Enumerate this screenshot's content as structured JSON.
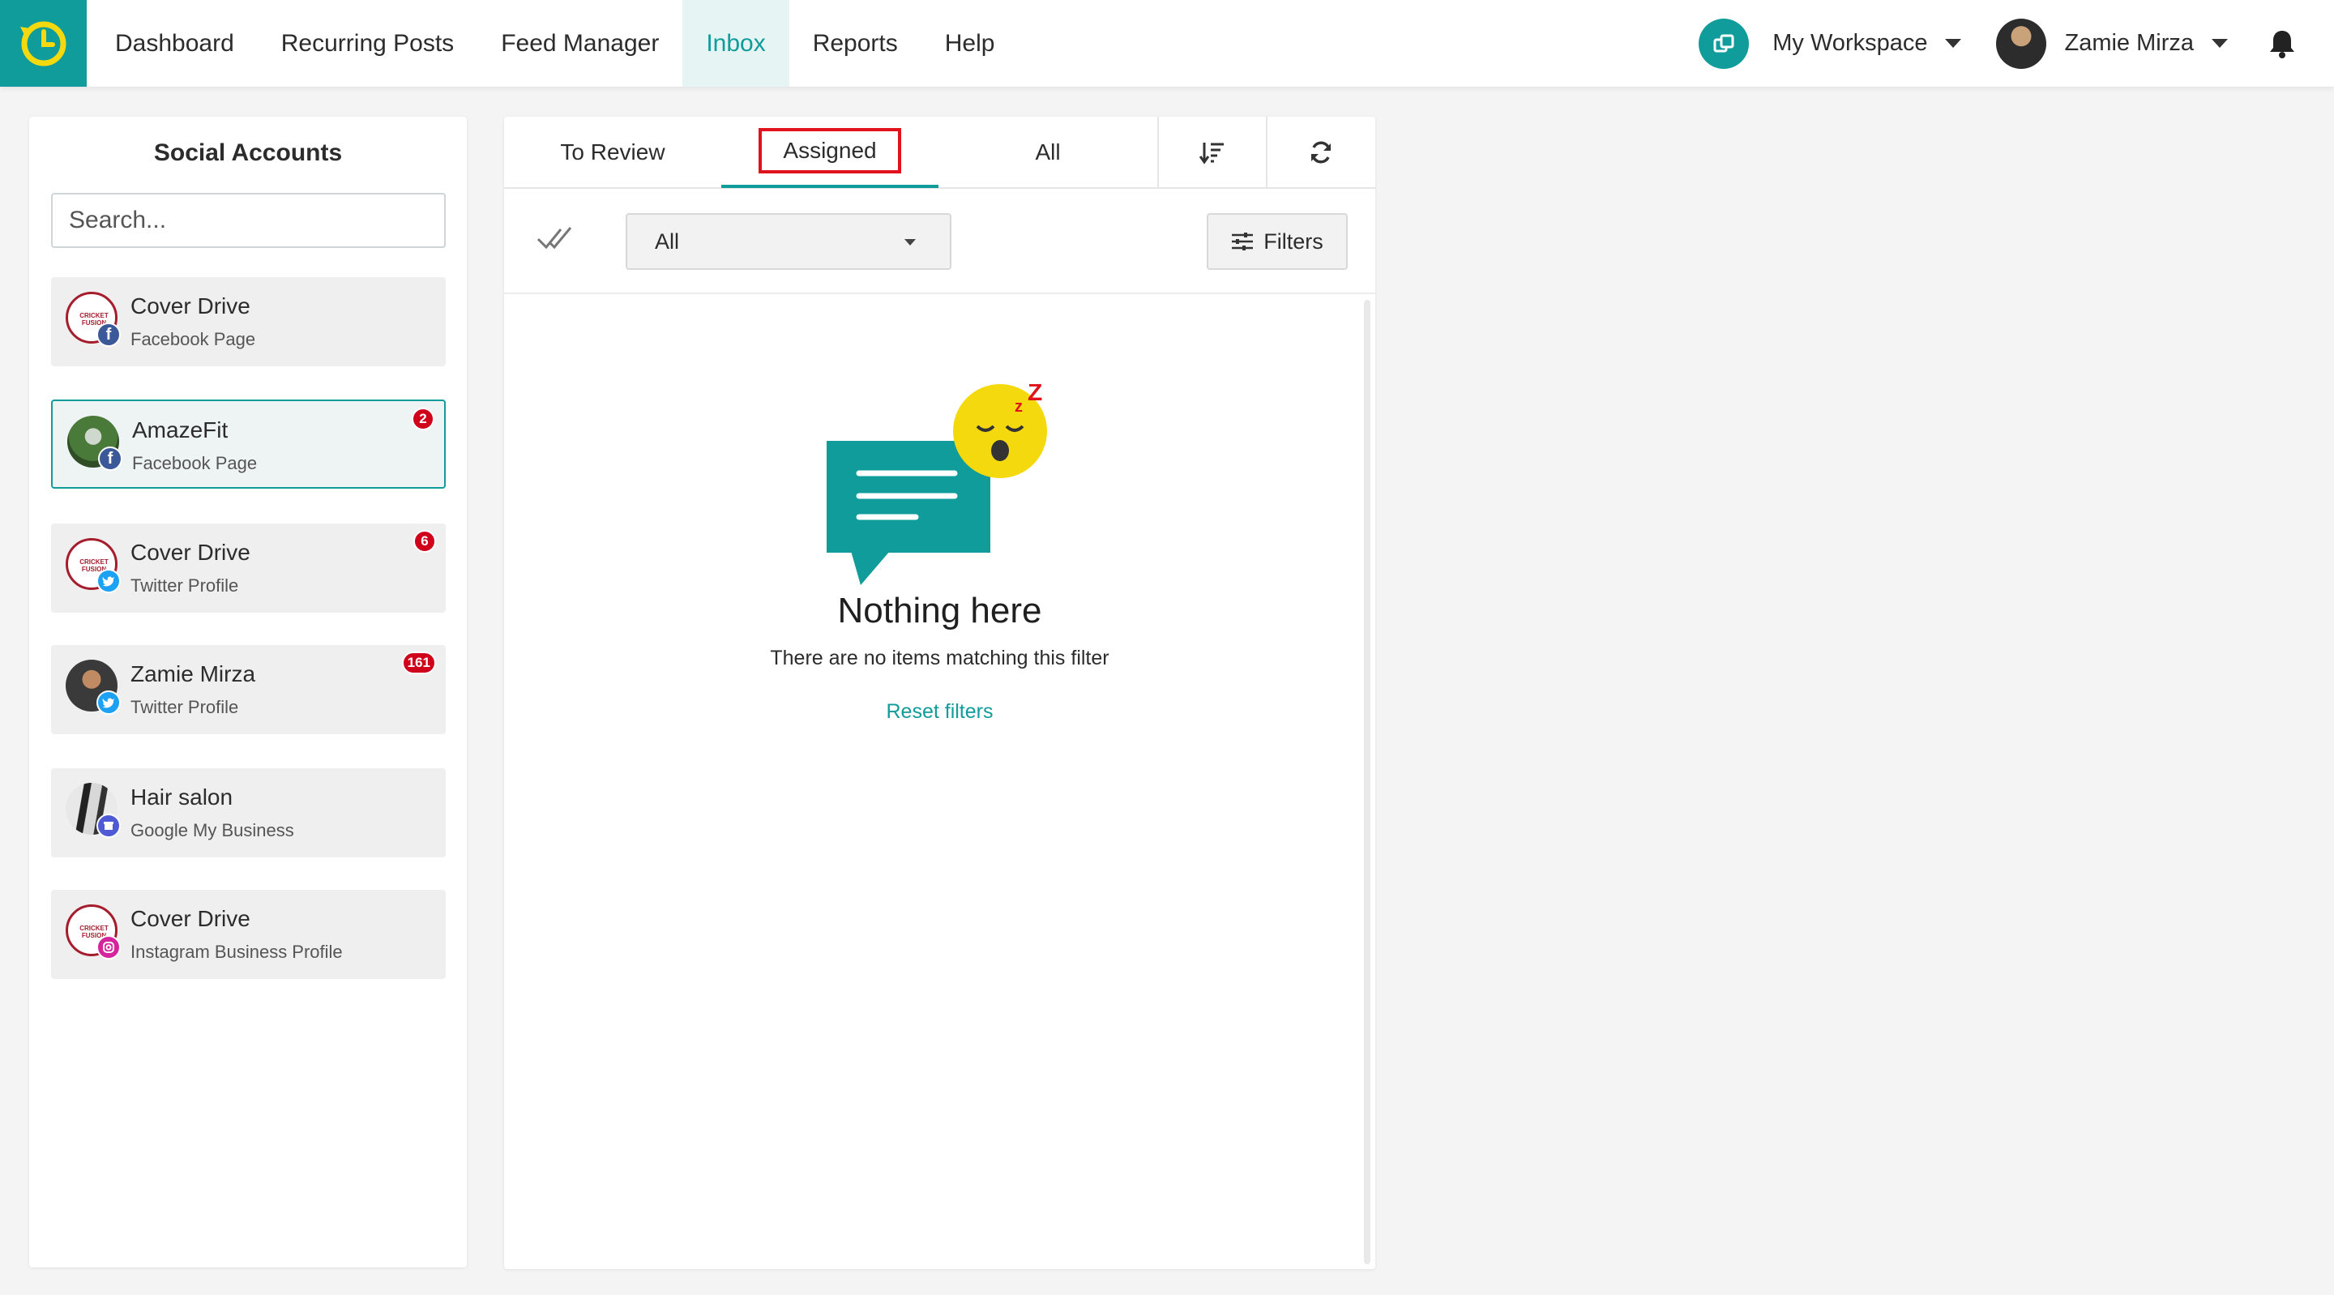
{
  "nav": {
    "items": [
      {
        "label": "Dashboard"
      },
      {
        "label": "Recurring Posts"
      },
      {
        "label": "Feed Manager"
      },
      {
        "label": "Inbox"
      },
      {
        "label": "Reports"
      },
      {
        "label": "Help"
      }
    ],
    "active": "Inbox",
    "workspace_label": "My Workspace",
    "user_label": "Zamie Mirza"
  },
  "sidebar": {
    "title": "Social Accounts",
    "search_placeholder": "Search...",
    "accounts": [
      {
        "name": "Cover Drive",
        "type": "Facebook Page",
        "network": "facebook",
        "badge": ""
      },
      {
        "name": "AmazeFit",
        "type": "Facebook Page",
        "network": "facebook",
        "badge": "2",
        "selected": true
      },
      {
        "name": "Cover Drive",
        "type": "Twitter Profile",
        "network": "twitter",
        "badge": "6"
      },
      {
        "name": "Zamie Mirza",
        "type": "Twitter Profile",
        "network": "twitter",
        "badge": "161"
      },
      {
        "name": "Hair salon",
        "type": "Google My Business",
        "network": "google-my-business",
        "badge": ""
      },
      {
        "name": "Cover Drive",
        "type": "Instagram Business Profile",
        "network": "instagram",
        "badge": ""
      }
    ],
    "logo_text": "CRICKET FUSION"
  },
  "main": {
    "tabs": [
      {
        "label": "To Review"
      },
      {
        "label": "Assigned"
      },
      {
        "label": "All"
      }
    ],
    "active_tab": "Assigned",
    "filter_select_value": "All",
    "filters_button": "Filters",
    "empty": {
      "title": "Nothing here",
      "subtitle": "There are no items matching this filter",
      "reset_link": "Reset filters"
    }
  },
  "colors": {
    "accent": "#0f9c9a",
    "badge": "#d0021b",
    "highlight_box": "#e0121b",
    "emoji": "#f5d90f"
  },
  "icons": [
    "clock-logo-icon",
    "workspace-icon",
    "bell-icon",
    "sort-icon",
    "refresh-icon",
    "check-all-icon",
    "filters-icon",
    "sleeping-emoji-icon",
    "chat-bubble-icon"
  ]
}
